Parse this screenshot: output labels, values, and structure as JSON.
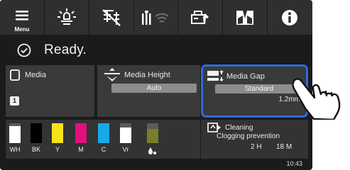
{
  "toolbar": {
    "menu_label": "Menu",
    "icons": [
      "menu-icon",
      "light-icon",
      "network-off-icon",
      "ink-wifi-icon",
      "maintenance-icon",
      "media-icon",
      "info-icon"
    ]
  },
  "status": {
    "text": "Ready."
  },
  "media_panel": {
    "label": "Media",
    "badge": "1"
  },
  "height_panel": {
    "label": "Media Height",
    "value": "Auto"
  },
  "gap_panel": {
    "label": "Media Gap",
    "value": "Standard",
    "measure": "1.2mm"
  },
  "inks": [
    {
      "code": "WH",
      "color": "#ffffff",
      "level": 0.85
    },
    {
      "code": "BK",
      "color": "#000000",
      "level": 1.0
    },
    {
      "code": "Y",
      "color": "#f7e31a",
      "level": 1.0
    },
    {
      "code": "M",
      "color": "#e0117e",
      "level": 1.0
    },
    {
      "code": "C",
      "color": "#1aa7e8",
      "level": 1.0
    },
    {
      "code": "Vr",
      "color": "#ffffff",
      "level": 0.8
    }
  ],
  "waste": {
    "color": "#7a7e2a",
    "level": 0.7
  },
  "cleaning": {
    "title": "Cleaning",
    "subtitle": "Clogging prevention",
    "hours": "2 H",
    "minutes": "18 M"
  },
  "clock": "10:43"
}
